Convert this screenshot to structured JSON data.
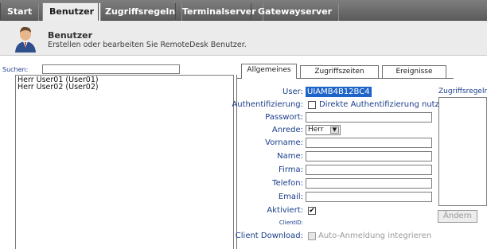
{
  "nav": {
    "tabs": [
      {
        "label": "Start"
      },
      {
        "label": "Benutzer"
      },
      {
        "label": "Zugriffsregeln"
      },
      {
        "label": "Terminalserver"
      },
      {
        "label": "Gatewayserver"
      }
    ],
    "active": "Benutzer"
  },
  "header": {
    "title": "Benutzer",
    "subtitle": "Erstellen oder bearbeiten Sie RemoteDesk Benutzer."
  },
  "left": {
    "search_label": "Suchen:",
    "search_value": "",
    "users": [
      "Herr User01 (User01)",
      "Herr User02 (User02)"
    ]
  },
  "subtabs": [
    {
      "label": "Allgemeines"
    },
    {
      "label": "Zugriffszeiten"
    },
    {
      "label": "Ereignisse"
    }
  ],
  "form": {
    "user_label": "User:",
    "user_value": "UIAMB4B12BC4",
    "auth_label": "Authentifizierung:",
    "auth_option": "Direkte Authentifizierung nutzen",
    "passwort_label": "Passwort:",
    "anrede_label": "Anrede:",
    "anrede_value": "Herr",
    "vorname_label": "Vorname:",
    "name_label": "Name:",
    "firma_label": "Firma:",
    "telefon_label": "Telefon:",
    "email_label": "Email:",
    "aktiviert_label": "Aktiviert:",
    "clientid_label": "ClientID:",
    "client_download_label": "Client Download:",
    "auto_anmeldung": "Auto-Anmeldung integrieren"
  },
  "zugriffsregeln": {
    "label": "Zugriffsregeln:",
    "button": "Ändern"
  },
  "colors": {
    "nav_bg": "#6e6e6e",
    "header_bg": "#ebebeb",
    "label_blue": "#1a3d8a",
    "selection": "#1e64c8"
  }
}
